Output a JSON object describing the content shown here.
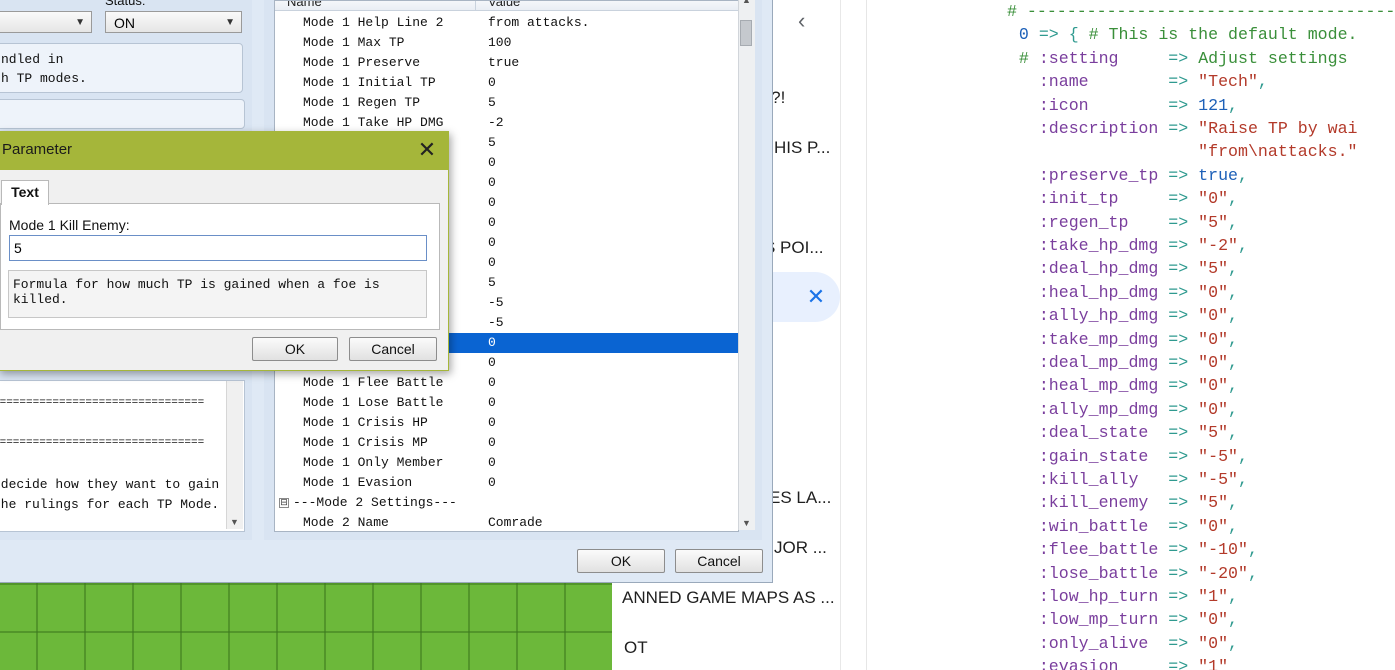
{
  "plugin_manager": {
    "status_label": "Status:",
    "status_value": "ON",
    "description_lines": [
      "ndled in",
      "h TP modes."
    ],
    "help_lines": [
      "================================",
      "",
      "================================",
      "",
      " decide how they want to gain",
      "the rulings for each TP Mode."
    ],
    "header_name": "Name",
    "header_value": "Value",
    "ok_label": "OK",
    "cancel_label": "Cancel",
    "rows": [
      {
        "name": "Mode 1 Help Line 2",
        "value": "from attacks."
      },
      {
        "name": "Mode 1 Max TP",
        "value": "100"
      },
      {
        "name": "Mode 1 Preserve",
        "value": "true"
      },
      {
        "name": "Mode 1 Initial TP",
        "value": "0"
      },
      {
        "name": "Mode 1 Regen TP",
        "value": "5"
      },
      {
        "name": "Mode 1 Take HP DMG",
        "value": "-2"
      },
      {
        "name": "",
        "value": "5"
      },
      {
        "name": "",
        "value": "0"
      },
      {
        "name": "",
        "value": "0"
      },
      {
        "name": "",
        "value": "0"
      },
      {
        "name": "",
        "value": "0"
      },
      {
        "name": "",
        "value": "0"
      },
      {
        "name": "",
        "value": "0"
      },
      {
        "name": "",
        "value": "5"
      },
      {
        "name": "",
        "value": "-5"
      },
      {
        "name": "",
        "value": "-5"
      },
      {
        "name": "",
        "value": "0"
      },
      {
        "name": "",
        "value": "0"
      },
      {
        "name": "Mode 1 Flee Battle",
        "value": "0"
      },
      {
        "name": "Mode 1 Lose Battle",
        "value": "0"
      },
      {
        "name": "Mode 1 Crisis HP",
        "value": "0"
      },
      {
        "name": "Mode 1 Crisis MP",
        "value": "0"
      },
      {
        "name": "Mode 1 Only Member",
        "value": "0"
      },
      {
        "name": "Mode 1 Evasion",
        "value": "0"
      },
      {
        "name": "---Mode 2 Settings---",
        "value": ""
      },
      {
        "name": "Mode 2 Name",
        "value": "Comrade"
      }
    ],
    "collapse_glyph": "⊟"
  },
  "dialog": {
    "title": "Parameter",
    "tab": "Text",
    "field_label": "Mode 1 Kill Enemy:",
    "field_value": "5",
    "help_text": "Formula for how much TP is gained when a foe is killed.",
    "ok_label": "OK",
    "cancel_label": "Cancel"
  },
  "browser_list": {
    "items": [
      "M?!",
      "HIS P...",
      "S POI...",
      "ES LA...",
      "JOR ...",
      "ANNED GAME MAPS AS ...",
      "OT"
    ]
  },
  "code": {
    "lines": [
      [
        [
          "c-comment",
          "# ------------------------------------------"
        ]
      ],
      [
        [
          "c-num",
          "  0"
        ],
        [
          "c-op",
          " => { "
        ],
        [
          "c-comment",
          "# This is the default mode."
        ]
      ],
      [
        [
          "c-comment",
          "  # "
        ],
        [
          "c-sym",
          ":setting"
        ],
        [
          "c-op",
          "     => "
        ],
        [
          "c-comment",
          "Adjust settings"
        ]
      ],
      [
        [
          "c-sym",
          "    :name"
        ],
        [
          "c-op",
          "        => "
        ],
        [
          "c-str",
          "\"Tech\""
        ],
        [
          "c-op",
          ","
        ]
      ],
      [
        [
          "c-sym",
          "    :icon"
        ],
        [
          "c-op",
          "        => "
        ],
        [
          "c-num",
          "121"
        ],
        [
          "c-op",
          ","
        ]
      ],
      [
        [
          "c-sym",
          "    :description"
        ],
        [
          "c-op",
          " => "
        ],
        [
          "c-str",
          "\"Raise TP by wai"
        ]
      ],
      [
        [
          "c-str",
          "                    \"from\\nattacks.\""
        ]
      ],
      [
        [
          "c-sym",
          "    :preserve_tp"
        ],
        [
          "c-op",
          " => "
        ],
        [
          "c-kw",
          "true"
        ],
        [
          "c-op",
          ","
        ]
      ],
      [
        [
          "c-sym",
          "    :init_tp"
        ],
        [
          "c-op",
          "     => "
        ],
        [
          "c-str",
          "\"0\""
        ],
        [
          "c-op",
          ","
        ]
      ],
      [
        [
          "c-sym",
          "    :regen_tp"
        ],
        [
          "c-op",
          "    => "
        ],
        [
          "c-str",
          "\"5\""
        ],
        [
          "c-op",
          ","
        ]
      ],
      [
        [
          "c-sym",
          "    :take_hp_dmg"
        ],
        [
          "c-op",
          " => "
        ],
        [
          "c-str",
          "\"-2\""
        ],
        [
          "c-op",
          ","
        ]
      ],
      [
        [
          "c-sym",
          "    :deal_hp_dmg"
        ],
        [
          "c-op",
          " => "
        ],
        [
          "c-str",
          "\"5\""
        ],
        [
          "c-op",
          ","
        ]
      ],
      [
        [
          "c-sym",
          "    :heal_hp_dmg"
        ],
        [
          "c-op",
          " => "
        ],
        [
          "c-str",
          "\"0\""
        ],
        [
          "c-op",
          ","
        ]
      ],
      [
        [
          "c-sym",
          "    :ally_hp_dmg"
        ],
        [
          "c-op",
          " => "
        ],
        [
          "c-str",
          "\"0\""
        ],
        [
          "c-op",
          ","
        ]
      ],
      [
        [
          "c-sym",
          "    :take_mp_dmg"
        ],
        [
          "c-op",
          " => "
        ],
        [
          "c-str",
          "\"0\""
        ],
        [
          "c-op",
          ","
        ]
      ],
      [
        [
          "c-sym",
          "    :deal_mp_dmg"
        ],
        [
          "c-op",
          " => "
        ],
        [
          "c-str",
          "\"0\""
        ],
        [
          "c-op",
          ","
        ]
      ],
      [
        [
          "c-sym",
          "    :heal_mp_dmg"
        ],
        [
          "c-op",
          " => "
        ],
        [
          "c-str",
          "\"0\""
        ],
        [
          "c-op",
          ","
        ]
      ],
      [
        [
          "c-sym",
          "    :ally_mp_dmg"
        ],
        [
          "c-op",
          " => "
        ],
        [
          "c-str",
          "\"0\""
        ],
        [
          "c-op",
          ","
        ]
      ],
      [
        [
          "c-sym",
          "    :deal_state"
        ],
        [
          "c-op",
          "  => "
        ],
        [
          "c-str",
          "\"5\""
        ],
        [
          "c-op",
          ","
        ]
      ],
      [
        [
          "c-sym",
          "    :gain_state"
        ],
        [
          "c-op",
          "  => "
        ],
        [
          "c-str",
          "\"-5\""
        ],
        [
          "c-op",
          ","
        ]
      ],
      [
        [
          "c-sym",
          "    :kill_ally"
        ],
        [
          "c-op",
          "   => "
        ],
        [
          "c-str",
          "\"-5\""
        ],
        [
          "c-op",
          ","
        ]
      ],
      [
        [
          "c-sym",
          "    :kill_enemy"
        ],
        [
          "c-op",
          "  => "
        ],
        [
          "c-str",
          "\"5\""
        ],
        [
          "c-op",
          ","
        ]
      ],
      [
        [
          "c-sym",
          "    :win_battle"
        ],
        [
          "c-op",
          "  => "
        ],
        [
          "c-str",
          "\"0\""
        ],
        [
          "c-op",
          ","
        ]
      ],
      [
        [
          "c-sym",
          "    :flee_battle"
        ],
        [
          "c-op",
          " => "
        ],
        [
          "c-str",
          "\"-10\""
        ],
        [
          "c-op",
          ","
        ]
      ],
      [
        [
          "c-sym",
          "    :lose_battle"
        ],
        [
          "c-op",
          " => "
        ],
        [
          "c-str",
          "\"-20\""
        ],
        [
          "c-op",
          ","
        ]
      ],
      [
        [
          "c-sym",
          "    :low_hp_turn"
        ],
        [
          "c-op",
          " => "
        ],
        [
          "c-str",
          "\"1\""
        ],
        [
          "c-op",
          ","
        ]
      ],
      [
        [
          "c-sym",
          "    :low_mp_turn"
        ],
        [
          "c-op",
          " => "
        ],
        [
          "c-str",
          "\"0\""
        ],
        [
          "c-op",
          ","
        ]
      ],
      [
        [
          "c-sym",
          "    :only_alive"
        ],
        [
          "c-op",
          "  => "
        ],
        [
          "c-str",
          "\"0\""
        ],
        [
          "c-op",
          ","
        ]
      ],
      [
        [
          "c-sym",
          "    :evasion"
        ],
        [
          "c-op",
          "     => "
        ],
        [
          "c-str",
          "\"1\""
        ]
      ]
    ]
  },
  "colors": {
    "dialog_title": "#a5b63a",
    "selection": "#0a64d2",
    "pill": "#e8f0fe",
    "close_x": "#1a73e8"
  }
}
